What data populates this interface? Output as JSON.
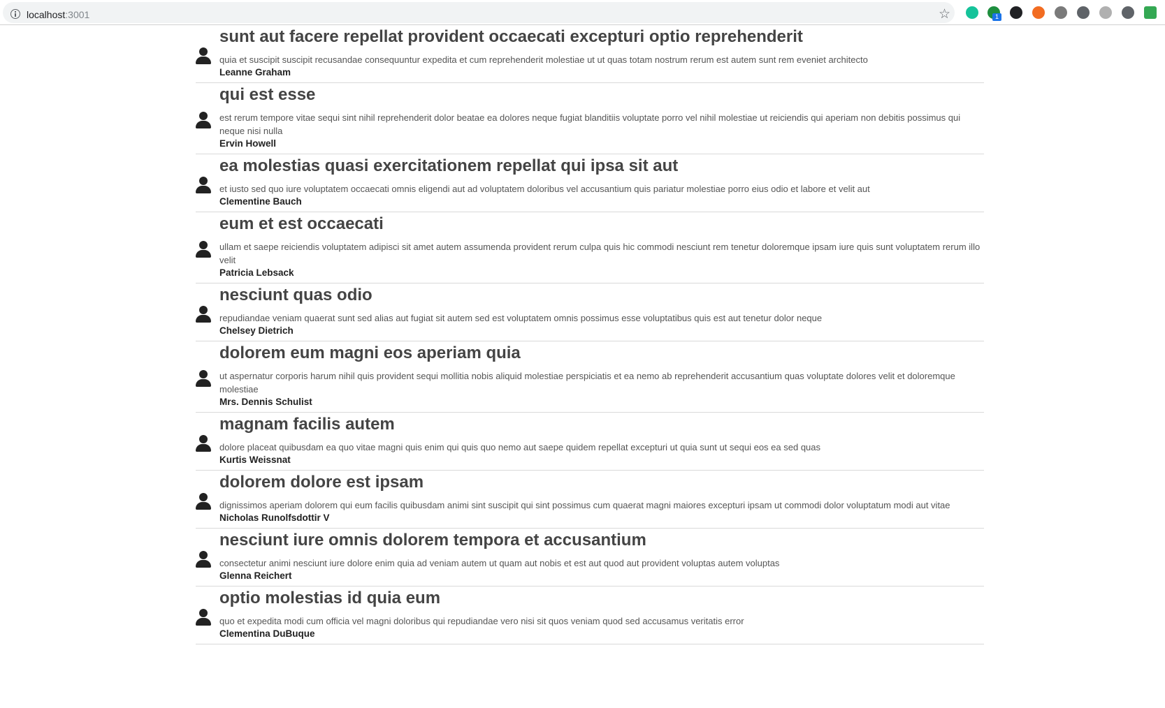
{
  "browser": {
    "url_host": "localhost",
    "url_port": ":3001",
    "extensions": [
      {
        "name": "grammarly-extension-icon",
        "color": "#15c39a"
      },
      {
        "name": "green-dot-extension-icon",
        "color": "#1e8e3e",
        "badge": "1"
      },
      {
        "name": "dark-circle-extension-icon",
        "color": "#202124"
      },
      {
        "name": "orange-extension-icon",
        "color": "#f26c21"
      },
      {
        "name": "camera-extension-icon",
        "color": "#7a7a7a"
      },
      {
        "name": "shield-extension-icon",
        "color": "#5f6368"
      },
      {
        "name": "grey-circle-extension-icon",
        "color": "#b0b0b0"
      },
      {
        "name": "eyedropper-extension-icon",
        "color": "#5f6368"
      },
      {
        "name": "green-square-extension-icon",
        "color": "#34a853"
      }
    ]
  },
  "posts": [
    {
      "title": "sunt aut facere repellat provident occaecati excepturi optio reprehenderit",
      "body": "quia et suscipit suscipit recusandae consequuntur expedita et cum reprehenderit molestiae ut ut quas totam nostrum rerum est autem sunt rem eveniet architecto",
      "author": "Leanne Graham"
    },
    {
      "title": "qui est esse",
      "body": "est rerum tempore vitae sequi sint nihil reprehenderit dolor beatae ea dolores neque fugiat blanditiis voluptate porro vel nihil molestiae ut reiciendis qui aperiam non debitis possimus qui neque nisi nulla",
      "author": "Ervin Howell"
    },
    {
      "title": "ea molestias quasi exercitationem repellat qui ipsa sit aut",
      "body": "et iusto sed quo iure voluptatem occaecati omnis eligendi aut ad voluptatem doloribus vel accusantium quis pariatur molestiae porro eius odio et labore et velit aut",
      "author": "Clementine Bauch"
    },
    {
      "title": "eum et est occaecati",
      "body": "ullam et saepe reiciendis voluptatem adipisci sit amet autem assumenda provident rerum culpa quis hic commodi nesciunt rem tenetur doloremque ipsam iure quis sunt voluptatem rerum illo velit",
      "author": "Patricia Lebsack"
    },
    {
      "title": "nesciunt quas odio",
      "body": "repudiandae veniam quaerat sunt sed alias aut fugiat sit autem sed est voluptatem omnis possimus esse voluptatibus quis est aut tenetur dolor neque",
      "author": "Chelsey Dietrich"
    },
    {
      "title": "dolorem eum magni eos aperiam quia",
      "body": "ut aspernatur corporis harum nihil quis provident sequi mollitia nobis aliquid molestiae perspiciatis et ea nemo ab reprehenderit accusantium quas voluptate dolores velit et doloremque molestiae",
      "author": "Mrs. Dennis Schulist"
    },
    {
      "title": "magnam facilis autem",
      "body": "dolore placeat quibusdam ea quo vitae magni quis enim qui quis quo nemo aut saepe quidem repellat excepturi ut quia sunt ut sequi eos ea sed quas",
      "author": "Kurtis Weissnat"
    },
    {
      "title": "dolorem dolore est ipsam",
      "body": "dignissimos aperiam dolorem qui eum facilis quibusdam animi sint suscipit qui sint possimus cum quaerat magni maiores excepturi ipsam ut commodi dolor voluptatum modi aut vitae",
      "author": "Nicholas Runolfsdottir V"
    },
    {
      "title": "nesciunt iure omnis dolorem tempora et accusantium",
      "body": "consectetur animi nesciunt iure dolore enim quia ad veniam autem ut quam aut nobis et est aut quod aut provident voluptas autem voluptas",
      "author": "Glenna Reichert"
    },
    {
      "title": "optio molestias id quia eum",
      "body": "quo et expedita modi cum officia vel magni doloribus qui repudiandae vero nisi sit quos veniam quod sed accusamus veritatis error",
      "author": "Clementina DuBuque"
    }
  ]
}
